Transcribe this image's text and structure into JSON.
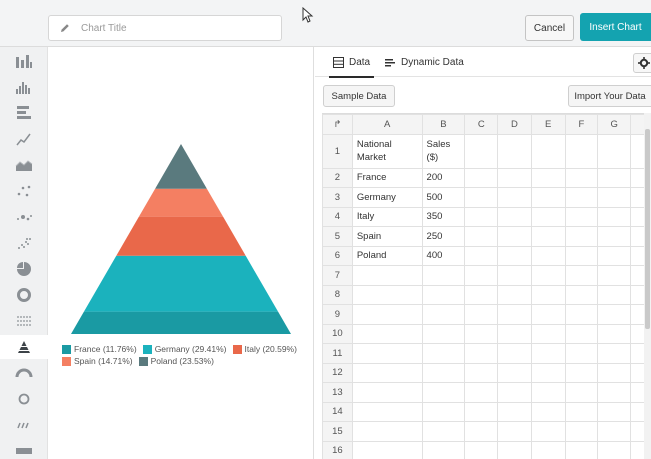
{
  "header": {
    "title_placeholder": "Chart Title",
    "cancel_label": "Cancel",
    "insert_label": "Insert Chart",
    "accent_color": "#14a3b0"
  },
  "rail": {
    "icons": [
      "column-chart-icon",
      "histogram-icon",
      "bar-chart-icon",
      "line-chart-icon",
      "area-chart-icon",
      "scatter-icon",
      "bubble-icon",
      "scatter-dense-icon",
      "pie-chart-icon",
      "donut-chart-icon",
      "dot-matrix-icon",
      "pyramid-chart-icon",
      "gauge-icon",
      "ring-icon",
      "sparkline-icon",
      "bar-icon"
    ],
    "active": "pyramid-chart-icon"
  },
  "tabs": {
    "data_label": "Data",
    "dynamic_label": "Dynamic Data"
  },
  "actions": {
    "sample_label": "Sample Data",
    "import_label": "Import Your Data"
  },
  "grid": {
    "corner": "↱",
    "columns": [
      "A",
      "B",
      "C",
      "D",
      "E",
      "F",
      "G"
    ],
    "row_numbers": [
      "1",
      "2",
      "3",
      "4",
      "5",
      "6",
      "7",
      "8",
      "9",
      "10",
      "11",
      "12",
      "13",
      "14",
      "15",
      "16"
    ],
    "header_row": [
      "National Market",
      "Sales ($)"
    ],
    "rows": [
      [
        "France",
        "200"
      ],
      [
        "Germany",
        "500"
      ],
      [
        "Italy",
        "350"
      ],
      [
        "Spain",
        "250"
      ],
      [
        "Poland",
        "400"
      ]
    ]
  },
  "chart_data": {
    "type": "pyramid",
    "categories": [
      "France",
      "Germany",
      "Italy",
      "Spain",
      "Poland"
    ],
    "values": [
      200,
      500,
      350,
      250,
      400
    ],
    "legend": [
      {
        "label": "France (11.76%)",
        "color": "#1a9aa3"
      },
      {
        "label": "Germany (29.41%)",
        "color": "#1bb2bd"
      },
      {
        "label": "Italy (20.59%)",
        "color": "#e9684a"
      },
      {
        "label": "Spain (14.71%)",
        "color": "#f47f62"
      },
      {
        "label": "Poland (23.53%)",
        "color": "#5a7a7e"
      }
    ],
    "stack_order_bottom_to_top": [
      "France",
      "Germany",
      "Italy",
      "Spain",
      "Poland"
    ]
  }
}
